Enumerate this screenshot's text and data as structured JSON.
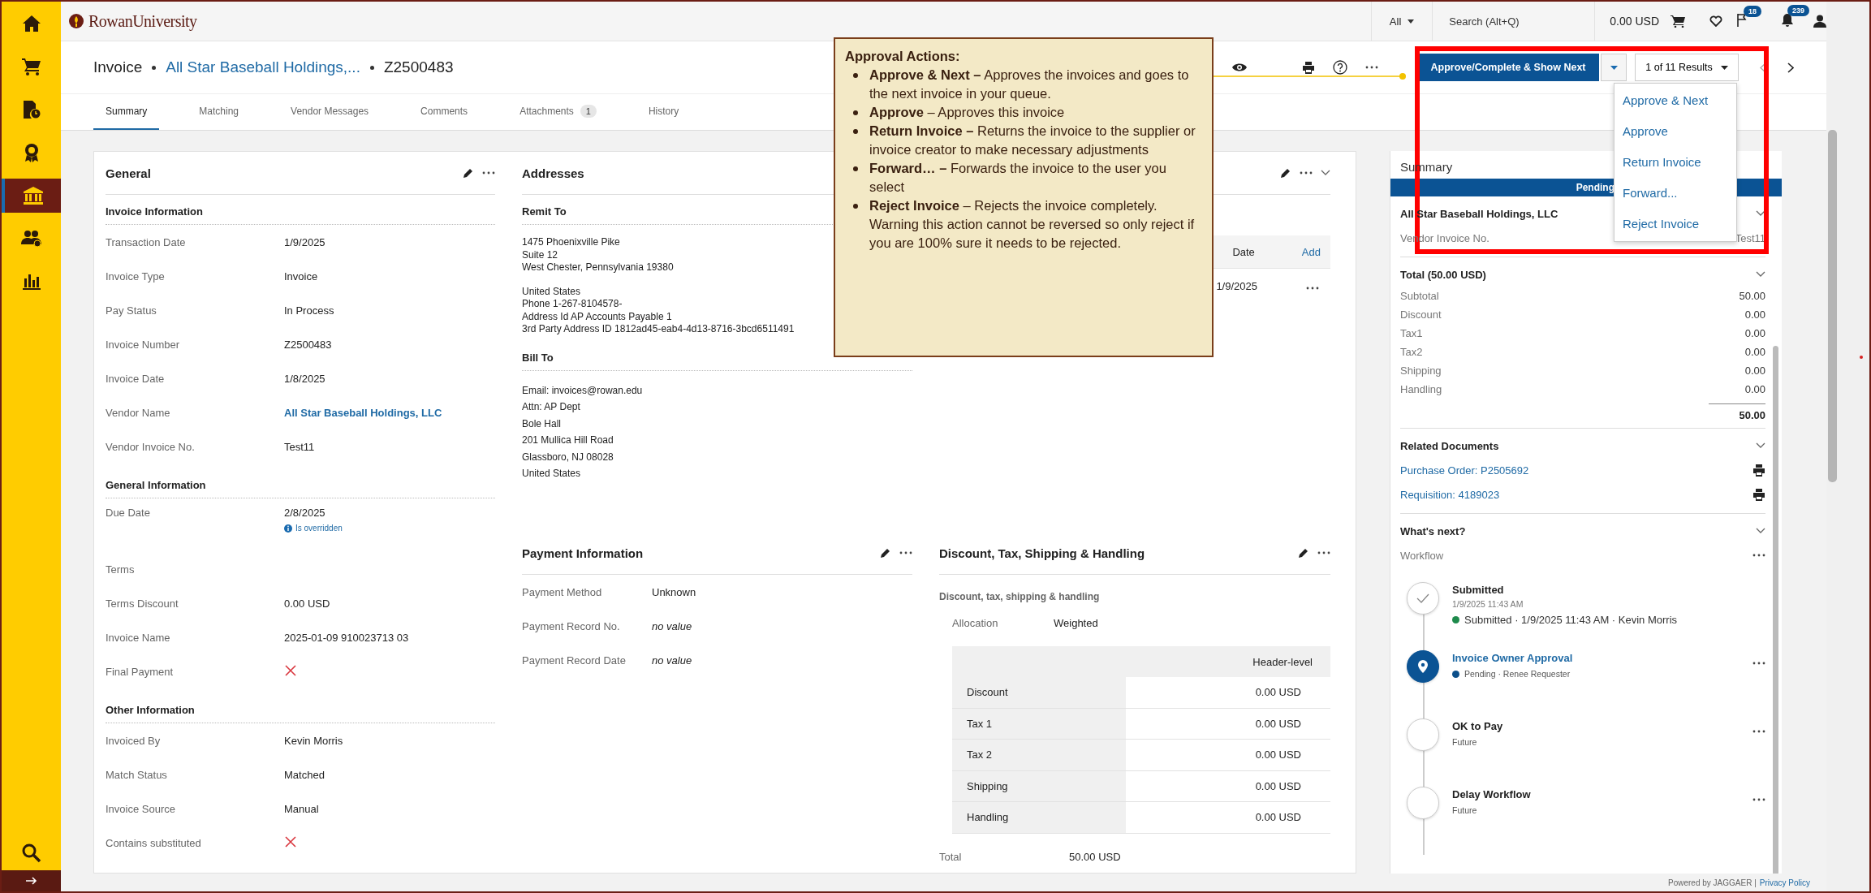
{
  "sidebar": {
    "items": [
      {
        "kind": "home",
        "selected": false
      },
      {
        "kind": "cart",
        "selected": false
      },
      {
        "kind": "document",
        "selected": false
      },
      {
        "kind": "award",
        "selected": false
      },
      {
        "kind": "bank",
        "selected": true
      },
      {
        "kind": "people",
        "selected": false
      },
      {
        "kind": "chart",
        "selected": false
      }
    ],
    "bottom": [
      {
        "kind": "search"
      },
      {
        "kind": "arrow"
      }
    ]
  },
  "topbar": {
    "logo": "RowanUniversity",
    "scope": "All",
    "search": {
      "placeholder": "Search (Alt+Q)"
    },
    "cart_total": "0.00 USD",
    "flag_count": "18",
    "notification_count": "239"
  },
  "header": {
    "breadcrumb": [
      {
        "text": "Invoice",
        "kind": "plain"
      },
      {
        "text": "All Star Baseball Holdings,...",
        "kind": "link"
      },
      {
        "text": "Z2500483",
        "kind": "plain"
      }
    ],
    "primary_action": "Approve/Complete & Show Next",
    "results": "1 of 11 Results"
  },
  "tabs": [
    {
      "label": "Summary",
      "selected": true
    },
    {
      "label": "Matching",
      "selected": false
    },
    {
      "label": "Vendor Messages",
      "selected": false
    },
    {
      "label": "Comments",
      "selected": false
    },
    {
      "label": "Attachments",
      "selected": false,
      "count": "1"
    },
    {
      "label": "History",
      "selected": false
    }
  ],
  "general": {
    "title": "General",
    "sections": [
      {
        "heading": "Invoice Information",
        "rows": [
          {
            "label": "Transaction Date",
            "value": "1/9/2025"
          },
          {
            "label": "Invoice Type",
            "value": "Invoice"
          },
          {
            "label": "Pay Status",
            "value": "In Process"
          },
          {
            "label": "Invoice Number",
            "value": "Z2500483"
          },
          {
            "label": "Invoice Date",
            "value": "1/8/2025"
          },
          {
            "label": "Vendor Name",
            "value": "All Star Baseball Holdings, LLC",
            "kind": "link"
          },
          {
            "label": "Vendor Invoice No.",
            "value": "Test11"
          }
        ]
      },
      {
        "heading": "General Information",
        "rows": [
          {
            "label": "Due Date",
            "value": "2/8/2025",
            "note": "Is overridden"
          },
          {
            "label": "Terms"
          },
          {
            "label": "Terms Discount",
            "value": "0.00 USD"
          },
          {
            "label": "Invoice Name",
            "value": "2025-01-09 910023713 03"
          },
          {
            "label": "Final Payment",
            "kind": "flag",
            "checked": false
          }
        ]
      },
      {
        "heading": "Other Information",
        "rows": [
          {
            "label": "Invoiced By",
            "value": "Kevin Morris"
          },
          {
            "label": "Match Status",
            "value": "Matched"
          },
          {
            "label": "Invoice Source",
            "value": "Manual"
          },
          {
            "label": "Contains substituted",
            "kind": "flag",
            "checked": false
          }
        ]
      }
    ]
  },
  "addresses": {
    "title": "Addresses",
    "blocks": [
      {
        "heading": "Remit To",
        "kind": "compact",
        "paragraphs": [
          [
            "1475 Phoenixville Pike",
            "Suite 12",
            "West Chester, Pennsylvania 19380"
          ],
          [
            "United States",
            "Phone 1-267-8104578-",
            "Address Id AP Accounts Payable 1",
            "3rd Party Address ID 1812ad45-eab4-4d13-8716-3bcd6511491"
          ]
        ]
      },
      {
        "heading": "Bill To",
        "kind": "spaced",
        "paragraphs": [
          [
            "Email: invoices@rowan.edu",
            "Attn: AP Dept",
            "Bole Hall",
            "201 Mullica Hill Road",
            "Glassboro, NJ 08028",
            "United States"
          ]
        ]
      }
    ]
  },
  "column_3": {
    "date_heading": "Date",
    "add_link": "Add",
    "rows": [
      {
        "date": "1/9/2025"
      }
    ]
  },
  "payment": {
    "title": "Payment Information",
    "rows": [
      {
        "label": "Payment Method",
        "value": "Unknown"
      },
      {
        "label": "Payment Record No.",
        "value": "no value",
        "kind": "empty"
      },
      {
        "label": "Payment Record Date",
        "value": "no value",
        "kind": "empty"
      }
    ]
  },
  "charges": {
    "title": "Discount, Tax, Shipping & Handling",
    "subtitle": "Discount, tax, shipping & handling",
    "allocation": {
      "label": "Allocation",
      "value": "Weighted"
    },
    "column_heading": "Header-level",
    "rows": [
      {
        "label": "Discount",
        "value": "0.00 USD"
      },
      {
        "label": "Tax 1",
        "value": "0.00 USD"
      },
      {
        "label": "Tax 2",
        "value": "0.00 USD"
      },
      {
        "label": "Shipping",
        "value": "0.00 USD"
      },
      {
        "label": "Handling",
        "value": "0.00 USD"
      }
    ],
    "total": {
      "label": "Total",
      "value": "50.00 USD"
    }
  },
  "summary": {
    "title": "Summary",
    "status": "Pending",
    "vendor": "All Star Baseball Holdings, LLC",
    "vendor_invoice_label": "Vendor Invoice No.",
    "vendor_invoice": "Test11",
    "total_heading": "Total (50.00 USD)",
    "lines": [
      {
        "label": "Subtotal",
        "value": "50.00"
      },
      {
        "label": "Discount",
        "value": "0.00"
      },
      {
        "label": "Tax1",
        "value": "0.00"
      },
      {
        "label": "Tax2",
        "value": "0.00"
      },
      {
        "label": "Shipping",
        "value": "0.00"
      },
      {
        "label": "Handling",
        "value": "0.00"
      }
    ],
    "total": "50.00",
    "related": {
      "heading": "Related Documents",
      "items": [
        "Purchase Order: P2505692",
        "Requisition: 4189023"
      ]
    },
    "next": {
      "heading": "What's next?",
      "workflow": "Workflow",
      "steps": [
        {
          "title": "Submitted",
          "kind": "done",
          "time": "1/9/2025 11:43 AM",
          "detail": "Submitted · 1/9/2025 11:43 AM · Kevin Morris",
          "color": "#1e8a4c"
        },
        {
          "title": "Invoice Owner Approval",
          "kind": "current",
          "detail": "Pending · Renee Requester",
          "color": "#0b4f8a"
        },
        {
          "title": "OK to Pay",
          "kind": "future",
          "detail": "Future"
        },
        {
          "title": "Delay Workflow",
          "kind": "future",
          "detail": "Future"
        }
      ]
    }
  },
  "action_menu": {
    "items": [
      "Approve & Next",
      "Approve",
      "Return Invoice",
      "Forward...",
      "Reject Invoice"
    ]
  },
  "callout": {
    "title": "Approval Actions:",
    "items": [
      "**Approve & Next –** Approves the invoices and goes to the next invoice in your queue.",
      "**Approve** – Approves this invoice",
      "**Return Invoice –** Returns the invoice to the supplier or invoice creator to make necessary adjustments",
      "**Forward… –** Forwards the invoice to the user you select",
      "**Reject Invoice** – Rejects the invoice completely. Warning this action cannot be reversed so only reject if you are 100% sure it needs to be rejected."
    ]
  },
  "footer": {
    "powered": "Powered by JAGGAER |",
    "link": "Privacy Policy"
  }
}
